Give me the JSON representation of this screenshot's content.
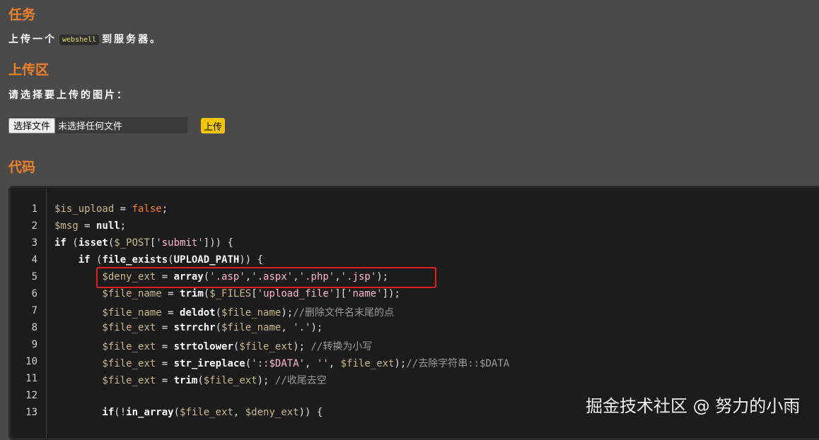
{
  "sections": {
    "task_title": "任务",
    "upload_title": "上传区",
    "code_title": "代码"
  },
  "task": {
    "prefix": "上传一个",
    "code": "webshell",
    "suffix": "到服务器。"
  },
  "upload": {
    "prompt": "请选择要上传的图片：",
    "choose_button": "选择文件",
    "file_status": "未选择任何文件",
    "submit_button": "上传"
  },
  "code": {
    "line_numbers": [
      "1",
      "2",
      "3",
      "4",
      "5",
      "6",
      "7",
      "8",
      "9",
      "10",
      "11",
      "12",
      "13"
    ],
    "lines": {
      "l1": [
        "$is_upload",
        " = ",
        "false",
        ";"
      ],
      "l2": [
        "$msg",
        " = ",
        "null",
        ";"
      ],
      "l3": [
        "if",
        " (",
        "isset",
        "(",
        "$_POST",
        "[",
        "'submit'",
        "])) {"
      ],
      "l4": [
        "    ",
        "if",
        " (",
        "file_exists",
        "(",
        "UPLOAD_PATH",
        ")) {"
      ],
      "l5": [
        "        ",
        "$deny_ext",
        " = ",
        "array",
        "(",
        "'.asp'",
        ",",
        "'.aspx'",
        ",",
        "'.php'",
        ",",
        "'.jsp'",
        ");"
      ],
      "l6": [
        "        ",
        "$file_name",
        " = ",
        "trim",
        "(",
        "$_FILES",
        "[",
        "'upload_file'",
        "][",
        "'name'",
        "]);"
      ],
      "l7": [
        "        ",
        "$file_name",
        " = ",
        "deldot",
        "(",
        "$file_name",
        ");",
        "//删除文件名末尾的点"
      ],
      "l8": [
        "        ",
        "$file_ext",
        " = ",
        "strrchr",
        "(",
        "$file_name",
        ", ",
        "'.'",
        ");"
      ],
      "l9": [
        "        ",
        "$file_ext",
        " = ",
        "strtolower",
        "(",
        "$file_ext",
        "); ",
        "//转换为小写"
      ],
      "l10": [
        "        ",
        "$file_ext",
        " = ",
        "str_ireplace",
        "(",
        "'::$DATA'",
        ", ",
        "''",
        ", ",
        "$file_ext",
        ");",
        "//去除字符串::$DATA"
      ],
      "l11": [
        "        ",
        "$file_ext",
        " = ",
        "trim",
        "(",
        "$file_ext",
        "); ",
        "//收尾去空"
      ],
      "l13": [
        "        ",
        "if",
        "(!",
        "in_array",
        "(",
        "$file_ext",
        ", ",
        "$deny_ext",
        ")) {"
      ]
    }
  },
  "watermark": "掘金技术社区 @ 努力的小雨",
  "colors": {
    "background": "#4a4a4a",
    "heading": "#f6802a",
    "code_background": "#1c1c1c",
    "highlight_box": "#e02020",
    "upload_button": "#f5c400"
  }
}
